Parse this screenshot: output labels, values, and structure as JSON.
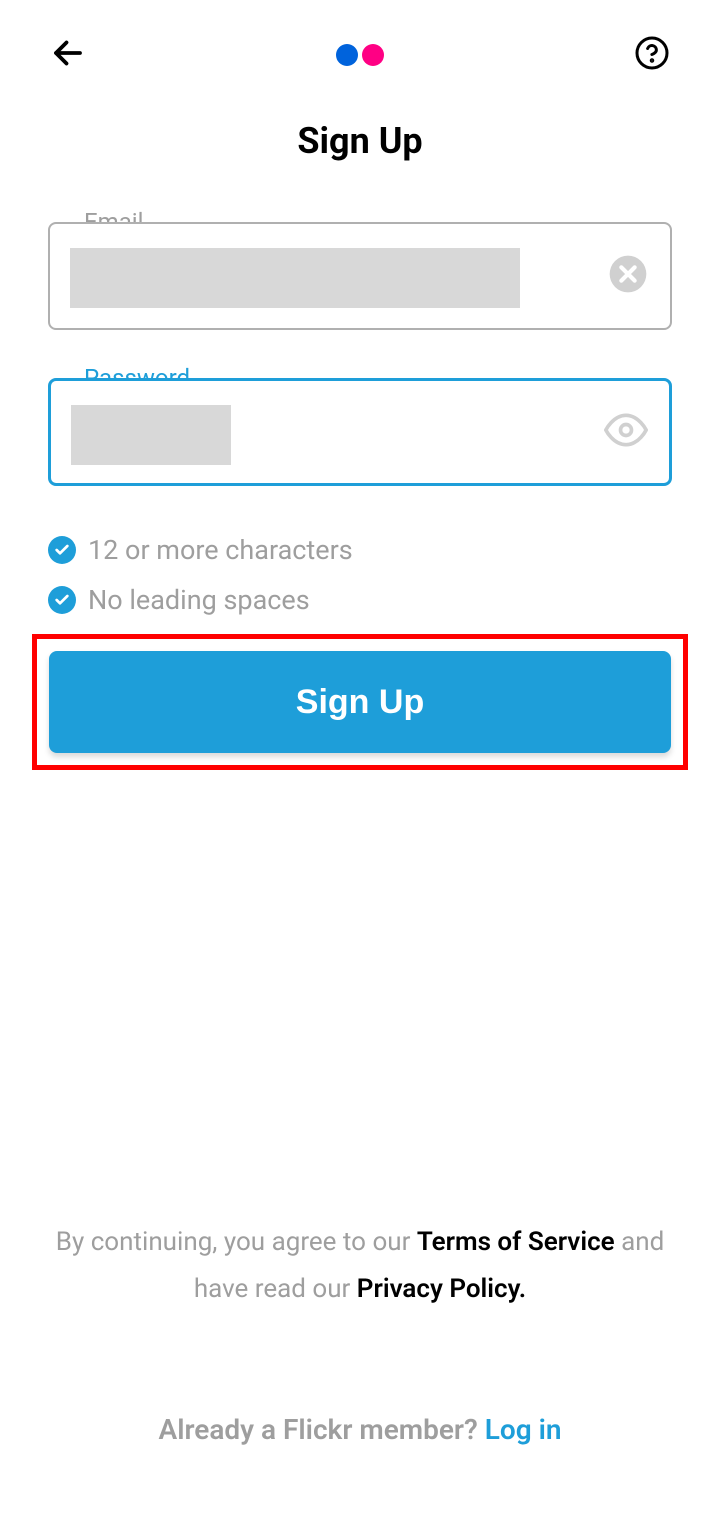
{
  "header": {
    "back_icon": "back-arrow",
    "help_icon": "help"
  },
  "title": "Sign Up",
  "form": {
    "email": {
      "label": "Email",
      "clear_icon": "clear"
    },
    "password": {
      "label": "Password",
      "visibility_icon": "eye"
    },
    "requirements": [
      {
        "text": "12 or more characters",
        "met": true
      },
      {
        "text": "No leading spaces",
        "met": true
      }
    ],
    "submit_label": "Sign Up"
  },
  "footer": {
    "terms_prefix": "By continuing, you agree to our ",
    "terms_link": "Terms of Service",
    "terms_middle": " and have read our ",
    "privacy_link": "Privacy Policy.",
    "login_prompt": "Already a Flickr member? ",
    "login_link": "Log in"
  },
  "colors": {
    "primary_blue": "#1e9ed9",
    "logo_blue": "#0063dc",
    "logo_pink": "#ff0084",
    "text_muted": "#9e9e9e",
    "highlight_red": "#ff0000"
  }
}
